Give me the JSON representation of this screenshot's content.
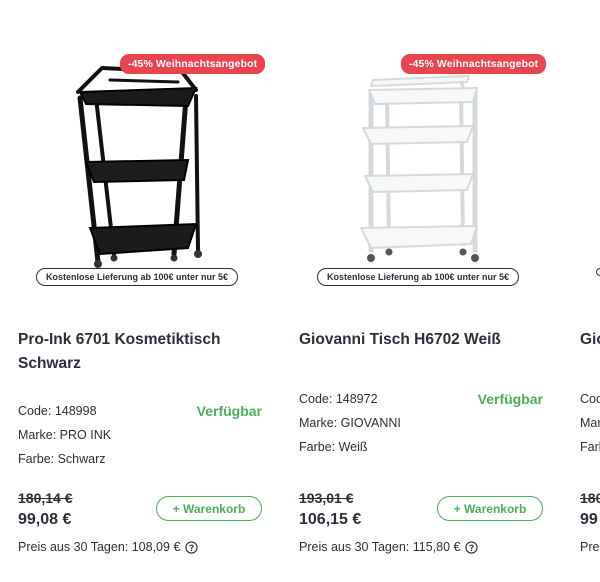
{
  "products": [
    {
      "promo_badge": "-45% Weihnachtsangebot",
      "shipping_note": "Kostenlose Lieferung ab 100€ unter nur 5€",
      "title": "Pro-Ink 6701 Kosmetiktisch Schwarz",
      "code": "Code: 148998",
      "brand": "Marke: PRO INK",
      "color": "Farbe: Schwarz",
      "availability": "Verfügbar",
      "old_price": "180,14 €",
      "price": "99,08 €",
      "cart_label": "+ Warenkorb",
      "price_history": "Preis aus 30 Tagen: 108,09 €",
      "image": "black-metal-three-tier-trolley"
    },
    {
      "promo_badge": "-45% Weihnachtsangebot",
      "shipping_note": "Kostenlose Lieferung ab 100€ unter nur 5€",
      "title": "Giovanni Tisch H6702 Weiß",
      "code": "Code: 148972",
      "brand": "Marke: GIOVANNI",
      "color": "Farbe: Weiß",
      "availability": "Verfügbar",
      "old_price": "193,01 €",
      "price": "106,15 €",
      "cart_label": "+ Warenkorb",
      "price_history": "Preis aus 30 Tagen: 115,80 €",
      "image": "white-four-tier-trolley"
    },
    {
      "title": "Gio",
      "code": "Cod",
      "brand": "Mar",
      "color": "Farb",
      "old_price": "180",
      "price": "99",
      "price_history": "Pre"
    }
  ],
  "colors": {
    "promo": "#e8454f",
    "available": "#4cb05a",
    "text": "#2b2f3a"
  },
  "icons": {
    "help": "question-circle-icon"
  }
}
